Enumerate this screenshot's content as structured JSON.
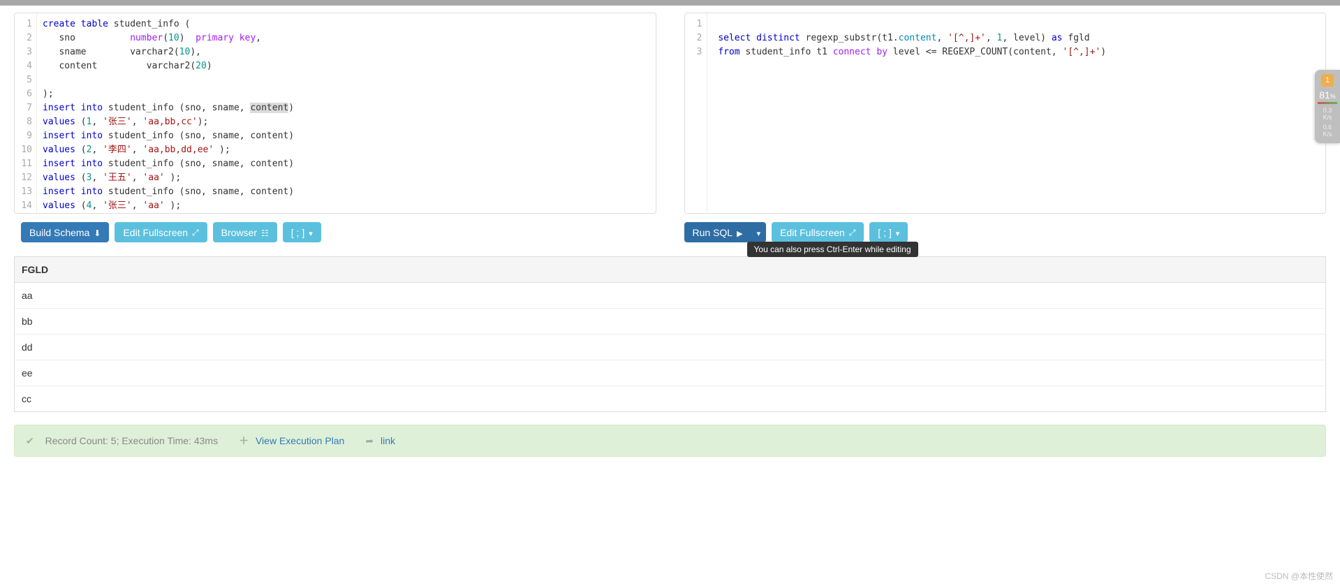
{
  "left_editor": {
    "lines": [
      [
        {
          "t": "create",
          "c": "kw-blue"
        },
        {
          "t": " "
        },
        {
          "t": "table",
          "c": "kw-blue"
        },
        {
          "t": " student_info ("
        }
      ],
      [
        {
          "t": "   sno          "
        },
        {
          "t": "number",
          "c": "kw-purple"
        },
        {
          "t": "("
        },
        {
          "t": "10",
          "c": "num"
        },
        {
          "t": ")  "
        },
        {
          "t": "primary",
          "c": "kw-purple"
        },
        {
          "t": " "
        },
        {
          "t": "key",
          "c": "kw-purple"
        },
        {
          "t": ","
        }
      ],
      [
        {
          "t": "   sname        varchar2("
        },
        {
          "t": "10",
          "c": "num"
        },
        {
          "t": "),"
        }
      ],
      [
        {
          "t": "   content         varchar2("
        },
        {
          "t": "20",
          "c": "num"
        },
        {
          "t": ")"
        }
      ],
      [
        {
          "t": ""
        }
      ],
      [
        {
          "t": ");"
        }
      ],
      [
        {
          "t": "insert",
          "c": "kw-blue"
        },
        {
          "t": " "
        },
        {
          "t": "into",
          "c": "kw-blue"
        },
        {
          "t": " student_info (sno, sname, "
        },
        {
          "t": "content",
          "c": "hl"
        },
        {
          "t": ")"
        }
      ],
      [
        {
          "t": "values",
          "c": "kw-blue"
        },
        {
          "t": " ("
        },
        {
          "t": "1",
          "c": "num"
        },
        {
          "t": ", "
        },
        {
          "t": "'张三'",
          "c": "str"
        },
        {
          "t": ", "
        },
        {
          "t": "'aa,bb,cc'",
          "c": "str"
        },
        {
          "t": ");"
        }
      ],
      [
        {
          "t": "insert",
          "c": "kw-blue"
        },
        {
          "t": " "
        },
        {
          "t": "into",
          "c": "kw-blue"
        },
        {
          "t": " student_info (sno, sname, content)"
        }
      ],
      [
        {
          "t": "values",
          "c": "kw-blue"
        },
        {
          "t": " ("
        },
        {
          "t": "2",
          "c": "num"
        },
        {
          "t": ", "
        },
        {
          "t": "'李四'",
          "c": "str"
        },
        {
          "t": ", "
        },
        {
          "t": "'aa,bb,dd,ee'",
          "c": "str"
        },
        {
          "t": " );"
        }
      ],
      [
        {
          "t": "insert",
          "c": "kw-blue"
        },
        {
          "t": " "
        },
        {
          "t": "into",
          "c": "kw-blue"
        },
        {
          "t": " student_info (sno, sname, content)"
        }
      ],
      [
        {
          "t": "values",
          "c": "kw-blue"
        },
        {
          "t": " ("
        },
        {
          "t": "3",
          "c": "num"
        },
        {
          "t": ", "
        },
        {
          "t": "'王五'",
          "c": "str"
        },
        {
          "t": ", "
        },
        {
          "t": "'aa'",
          "c": "str"
        },
        {
          "t": " );"
        }
      ],
      [
        {
          "t": "insert",
          "c": "kw-blue"
        },
        {
          "t": " "
        },
        {
          "t": "into",
          "c": "kw-blue"
        },
        {
          "t": " student_info (sno, sname, content)"
        }
      ],
      [
        {
          "t": "values",
          "c": "kw-blue"
        },
        {
          "t": " ("
        },
        {
          "t": "4",
          "c": "num"
        },
        {
          "t": ", "
        },
        {
          "t": "'张三'",
          "c": "str"
        },
        {
          "t": ", "
        },
        {
          "t": "'aa'",
          "c": "str"
        },
        {
          "t": " );"
        }
      ]
    ]
  },
  "right_editor": {
    "lines": [
      [
        {
          "t": ""
        }
      ],
      [
        {
          "t": " "
        },
        {
          "t": "select",
          "c": "kw-blue"
        },
        {
          "t": " "
        },
        {
          "t": "distinct",
          "c": "kw-blue"
        },
        {
          "t": " regexp_substr(t1."
        },
        {
          "t": "content",
          "c": "tbl"
        },
        {
          "t": ", "
        },
        {
          "t": "'[^,]+'",
          "c": "str"
        },
        {
          "t": ", "
        },
        {
          "t": "1",
          "c": "num"
        },
        {
          "t": ", level) "
        },
        {
          "t": "as",
          "c": "kw-blue"
        },
        {
          "t": " fgld"
        }
      ],
      [
        {
          "t": " "
        },
        {
          "t": "from",
          "c": "kw-blue"
        },
        {
          "t": " student_info t1 "
        },
        {
          "t": "connect",
          "c": "kw-purple"
        },
        {
          "t": " "
        },
        {
          "t": "by",
          "c": "kw-purple"
        },
        {
          "t": " level <= REGEXP_COUNT(content, "
        },
        {
          "t": "'[^,]+'",
          "c": "str"
        },
        {
          "t": ")"
        }
      ]
    ]
  },
  "buttons": {
    "build_schema": "Build Schema",
    "edit_fullscreen": "Edit Fullscreen",
    "browser": "Browser",
    "semicolon_menu": "[ ; ]",
    "run_sql": "Run SQL",
    "tooltip": "You can also press Ctrl-Enter while editing"
  },
  "results": {
    "header": "FGLD",
    "rows": [
      "aa",
      "bb",
      "dd",
      "ee",
      "cc"
    ]
  },
  "status": {
    "record_text": "Record Count: 5; Execution Time: 43ms",
    "view_plan": "View Execution Plan",
    "link": "link"
  },
  "side_widget": {
    "badge": "1",
    "pct": "81",
    "pct_suffix": "%",
    "m1": "0.3",
    "u1": "K/s",
    "m2": "0.6",
    "u2": "K/s"
  },
  "watermark": "CSDN @本性使然"
}
